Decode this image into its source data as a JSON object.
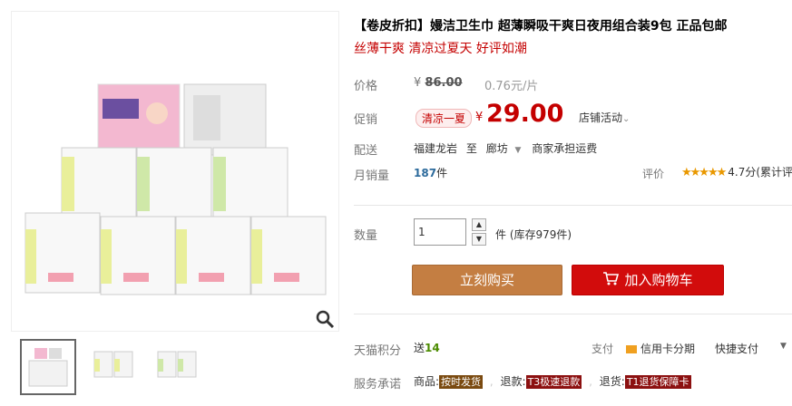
{
  "product": {
    "title": "【卷皮折扣】嫚洁卫生巾 超薄瞬吸干爽日夜用组合装9包 正品包邮",
    "subtitle": "丝薄干爽 清凉过夏天 好评如潮"
  },
  "price": {
    "label": "价格",
    "currency": "¥",
    "old": "86.00",
    "unit_price": "0.76元/片"
  },
  "promo": {
    "label": "促销",
    "tag": "清凉一夏",
    "currency": "¥",
    "price": "29.00",
    "shop_activity": "店铺活动"
  },
  "delivery": {
    "label": "配送",
    "from": "福建龙岩",
    "to_word": "至",
    "dest": "廊坊",
    "shipping": "商家承担运费"
  },
  "sales": {
    "label": "月销量",
    "count": "187",
    "unit": "件",
    "rating_label": "评价",
    "stars": "★★★★★",
    "rating_text": "4.7分(累计评"
  },
  "quantity": {
    "label": "数量",
    "value": "1",
    "stock": "件 (库存979件)"
  },
  "buttons": {
    "buy": "立刻购买",
    "cart": "加入购物车"
  },
  "points": {
    "label": "天猫积分",
    "send": "送",
    "amount": "14",
    "pay_label": "支付",
    "credit": "信用卡分期",
    "quick": "快捷支付"
  },
  "service": {
    "label": "服务承诺",
    "goods_label": "商品:",
    "goods_badge": "按时发货",
    "refund_label": "退款:",
    "refund_badge": "T3极速退款",
    "return_label": "退货:",
    "return_badge": "T1退货保障卡"
  },
  "colors": {
    "accent_red": "#c40000",
    "buy_button": "#c47e42",
    "cart_button": "#d20c0c"
  }
}
